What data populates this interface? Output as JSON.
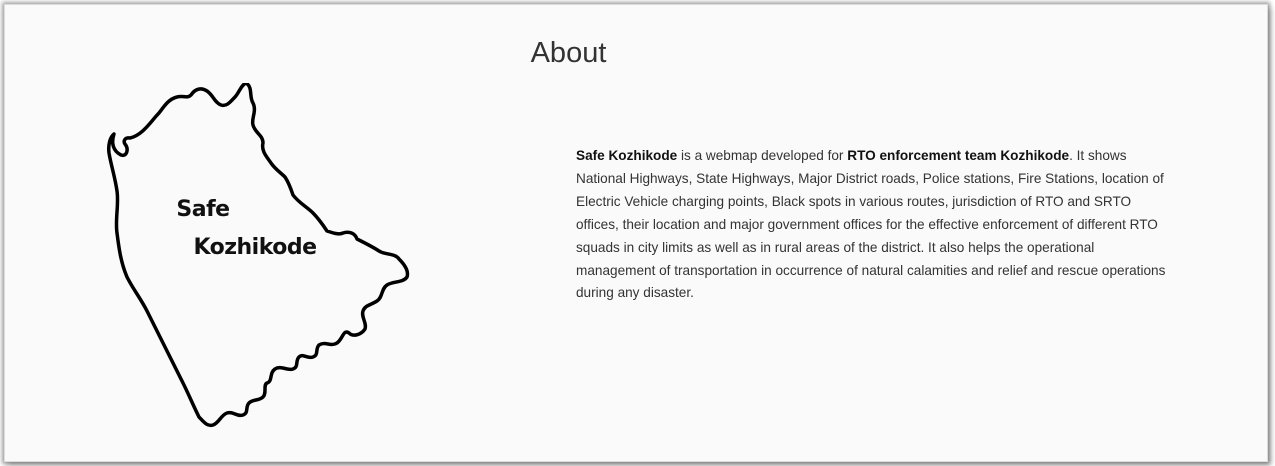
{
  "about": {
    "title": "About",
    "logo": {
      "line1": "Safe",
      "line2": "Kozhikode"
    },
    "description": {
      "app_name": "Safe Kozhikode",
      "intro": " is a webmap developed for ",
      "team": "RTO enforcement team Kozhikode",
      "body": ". It shows National Highways, State Highways, Major District roads, Police stations, Fire Stations, location of Electric Vehicle charging points, Black spots in various routes, jurisdiction of RTO and SRTO offices, their location and major government offices for the effective enforcement of different RTO squads in city limits as well as in rural areas of the district. It also helps the operational management of transportation in occurrence of natural calamities and relief and rescue operations during any disaster."
    }
  },
  "colors": {
    "background": "#fafafa",
    "text": "#333333",
    "outline": "#000000"
  }
}
